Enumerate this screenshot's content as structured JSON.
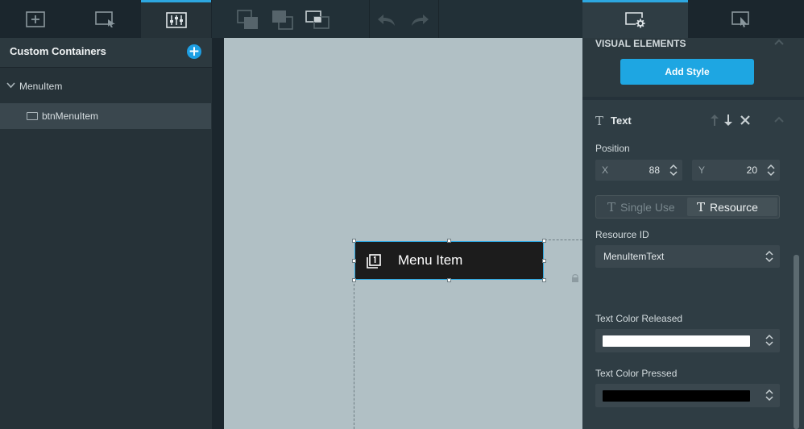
{
  "left_panel": {
    "tabs": [
      {
        "icon": "add-icon"
      },
      {
        "icon": "select-icon"
      },
      {
        "icon": "properties-icon",
        "active": true
      }
    ],
    "section_title": "Custom Containers",
    "tree": {
      "group_label": "MenuItem",
      "item_label": "btnMenuItem"
    }
  },
  "toolbar": {
    "buttons": [
      "bring-forward-icon",
      "send-backward-icon",
      "align-icon",
      "undo-icon",
      "redo-icon"
    ]
  },
  "canvas": {
    "menu_item": {
      "label": "Menu Item",
      "icon": "layers-numbered-icon"
    }
  },
  "right_panel": {
    "tabs": [
      {
        "icon": "screen-settings-icon",
        "active": true
      },
      {
        "icon": "interaction-icon"
      }
    ],
    "visual_elements": {
      "title": "VISUAL ELEMENTS",
      "add_style_label": "Add Style"
    },
    "text_element": {
      "icon_glyph": "T",
      "title": "Text",
      "position_label": "Position",
      "x_axis": "X",
      "x_value": "88",
      "y_axis": "Y",
      "y_value": "20",
      "mode_single_use": "Single Use",
      "mode_resource": "Resource",
      "mode_glyph": "T",
      "selected_mode": "Resource",
      "resource_id_label": "Resource ID",
      "resource_id_value": "MenuItemText",
      "text_color_released_label": "Text Color Released",
      "text_color_released": "#ffffff",
      "text_color_pressed_label": "Text Color Pressed",
      "text_color_pressed": "#000000"
    }
  },
  "colors": {
    "accent": "#1ea6e2",
    "panel": "#2f3d44",
    "canvas": "#b1c0c5"
  }
}
